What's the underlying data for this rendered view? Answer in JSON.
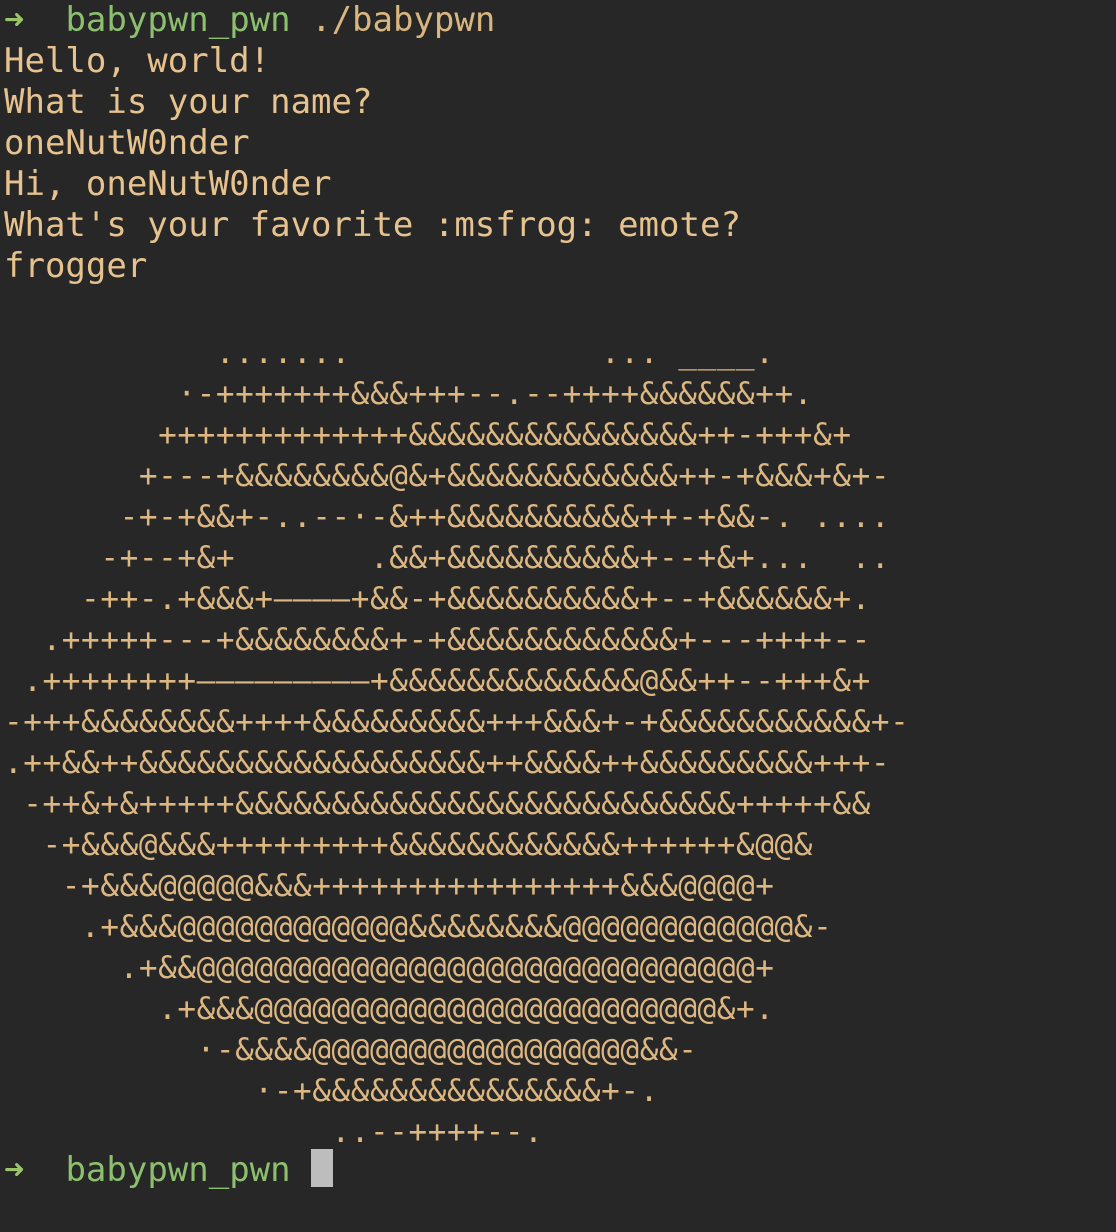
{
  "prompt": {
    "arrow": "➜",
    "dir": "babypwn_pwn",
    "command": "./babypwn"
  },
  "output": [
    "Hello, world!",
    "What is your name?",
    "oneNutW0nder",
    "Hi, oneNutW0nder",
    "What's your favorite :msfrog: emote?",
    "frogger"
  ],
  "ascii_art": [
    "           .......             ... ____.",
    "         ·-+++++++&&&+++--.--++++&&&&&&++.",
    "        +++++++++++++&&&&&&&&&&&&&&&++-+++&+",
    "       +---+&&&&&&&&@&+&&&&&&&&&&&&++-+&&&+&+-",
    "      -+-+&&+-..--·-&++&&&&&&&&&&++-+&&-. ....",
    "     -+--+&+       .&&+&&&&&&&&&&+--+&+...  ..",
    "    -++-.+&&&+————+&&-+&&&&&&&&&&+--+&&&&&&+.",
    "  .+++++---+&&&&&&&&+-+&&&&&&&&&&&&+---++++--",
    " .++++++++—————————+&&&&&&&&&&&&&@&&++--+++&+",
    "-+++&&&&&&&&++++&&&&&&&&&+++&&&+-+&&&&&&&&&&&+-",
    ".++&&++&&&&&&&&&&&&&&&&&&++&&&&++&&&&&&&&&+++-",
    " -++&+&+++++&&&&&&&&&&&&&&&&&&&&&&&&&&+++++&&",
    "  -+&&&@&&&+++++++++&&&&&&&&&&&&++++++&@@&",
    "   -+&&&@@@@@&&&++++++++++++++++&&&@@@@+",
    "    .+&&&@@@@@@@@@@@@&&&&&&&&@@@@@@@@@@@@&-",
    "      .+&&@@@@@@@@@@@@@@@@@@@@@@@@@@@@@+",
    "        .+&&&@@@@@@@@@@@@@@@@@@@@@@@@&+.",
    "          ·-&&&&@@@@@@@@@@@@@@@@@&&-",
    "             ·-+&&&&&&&&&&&&&&&+-.",
    "                 ..--++++--."
  ],
  "final_prompt": {
    "arrow": "➜",
    "dir": "babypwn_pwn"
  },
  "colors": {
    "background": "#272727",
    "text": "#e6c28e",
    "prompt_arrow": "#9ac46a",
    "prompt_dir": "#8cc06e",
    "cursor": "#bdbdbd"
  }
}
